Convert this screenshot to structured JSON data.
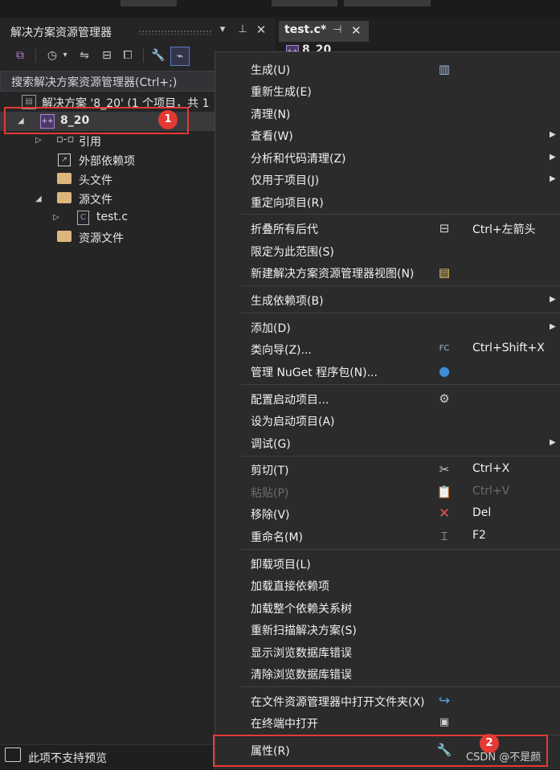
{
  "solution_explorer": {
    "title": "解决方案资源管理器",
    "search_placeholder": "搜索解决方案资源管理器(Ctrl+;)",
    "tree": {
      "solution": "解决方案 '8_20' (1 个项目，共 1",
      "project": "8_20",
      "references": "引用",
      "external_deps": "外部依赖项",
      "header_files": "头文件",
      "source_files": "源文件",
      "test_c": "test.c",
      "resource_files": "资源文件"
    }
  },
  "editor": {
    "tab_title": "test.c*",
    "project_hint": "8_20"
  },
  "context_menu": {
    "build": "生成(U)",
    "rebuild": "重新生成(E)",
    "clean": "清理(N)",
    "view": "查看(W)",
    "analyze": "分析和代码清理(Z)",
    "project_only": "仅用于项目(J)",
    "retarget": "重定向项目(R)",
    "collapse_all": "折叠所有后代",
    "collapse_all_shortcut": "Ctrl+左箭头",
    "scope_to_this": "限定为此范围(S)",
    "new_se_view": "新建解决方案资源管理器视图(N)",
    "build_deps": "生成依赖项(B)",
    "add": "添加(D)",
    "class_wizard": "类向导(Z)...",
    "class_wizard_shortcut": "Ctrl+Shift+X",
    "manage_nuget": "管理 NuGet 程序包(N)...",
    "config_startup": "配置启动项目...",
    "set_startup": "设为启动项目(A)",
    "debug": "调试(G)",
    "cut": "剪切(T)",
    "cut_shortcut": "Ctrl+X",
    "paste": "粘贴(P)",
    "paste_shortcut": "Ctrl+V",
    "remove": "移除(V)",
    "remove_shortcut": "Del",
    "rename": "重命名(M)",
    "rename_shortcut": "F2",
    "unload": "卸载项目(L)",
    "load_direct_deps": "加载直接依赖项",
    "load_all_deps": "加载整个依赖关系树",
    "rescan": "重新扫描解决方案(S)",
    "show_db_errors": "显示浏览数据库错误",
    "clear_db_errors": "清除浏览数据库错误",
    "open_folder": "在文件资源管理器中打开文件夹(X)",
    "open_terminal": "在终端中打开",
    "properties": "属性(R)"
  },
  "status_bar": {
    "preview_text": "此项不支持预览"
  },
  "annotations": {
    "badge_1": "1",
    "badge_2": "2",
    "color": "#e53935"
  },
  "watermark": "CSDN @不是颜"
}
